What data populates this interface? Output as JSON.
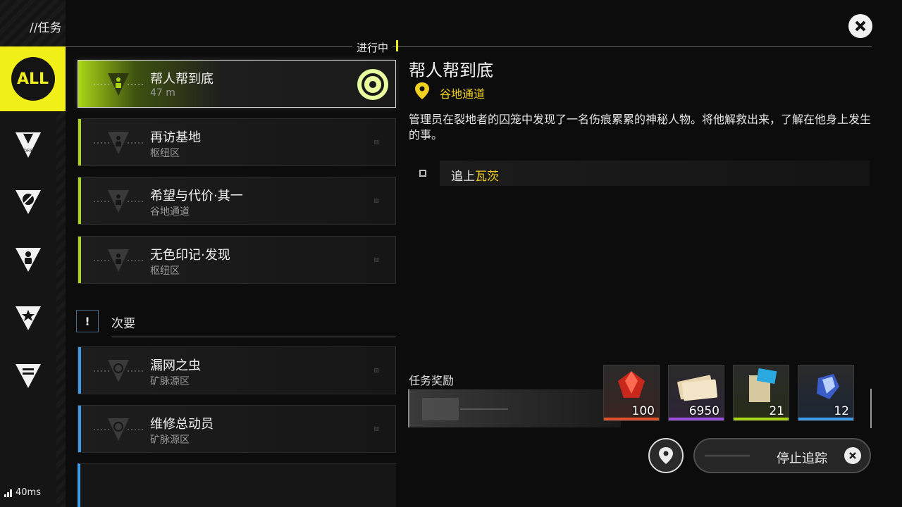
{
  "header": {
    "title": "//任务",
    "in_progress": "进行中"
  },
  "rail": {
    "all_label": "ALL",
    "items": [
      {
        "name": "endfield",
        "icon": "endfield-icon",
        "label": "ENDFIELD"
      },
      {
        "name": "exploration",
        "icon": "compass-icon"
      },
      {
        "name": "character",
        "icon": "person-icon"
      },
      {
        "name": "favorite",
        "icon": "star-icon"
      },
      {
        "name": "facility",
        "icon": "battery-icon"
      }
    ]
  },
  "quests": [
    {
      "name": "帮人帮到底",
      "sub": "47 m",
      "accent": "#a9d616",
      "active": true
    },
    {
      "name": "再访基地",
      "sub": "枢纽区",
      "accent": "#a9d616"
    },
    {
      "name": "希望与代价·其一",
      "sub": "谷地通道",
      "accent": "#a9d616"
    },
    {
      "name": "无色印记·发现",
      "sub": "枢纽区",
      "accent": "#a9d616"
    }
  ],
  "secondary": {
    "icon_text": "!",
    "label": "次要",
    "quests": [
      {
        "name": "漏网之虫",
        "sub": "矿脉源区",
        "accent": "#3d9be8"
      },
      {
        "name": "维修总动员",
        "sub": "矿脉源区",
        "accent": "#3d9be8"
      }
    ]
  },
  "detail": {
    "title": "帮人帮到底",
    "location": "谷地通道",
    "description": "管理员在裂地者的囚笼中发现了一名伤痕累累的神秘人物。将他解救出来，了解在他身上发生的事。",
    "objective_prefix": "追上",
    "objective_target": "瓦茨"
  },
  "rewards": {
    "label": "任务奖励",
    "items": [
      {
        "name": "crystal",
        "count": "100",
        "color": "#e0502a"
      },
      {
        "name": "currency",
        "count": "6950",
        "color": "#9b4ee0"
      },
      {
        "name": "exp-record",
        "count": "21",
        "color": "#a9d616"
      },
      {
        "name": "material",
        "count": "12",
        "color": "#3d9be8"
      }
    ]
  },
  "buttons": {
    "stop_tracking": "停止追踪"
  },
  "status": {
    "ping": "40ms"
  },
  "colors": {
    "accent_yellow": "#f0f018",
    "highlight": "#f0d020"
  }
}
